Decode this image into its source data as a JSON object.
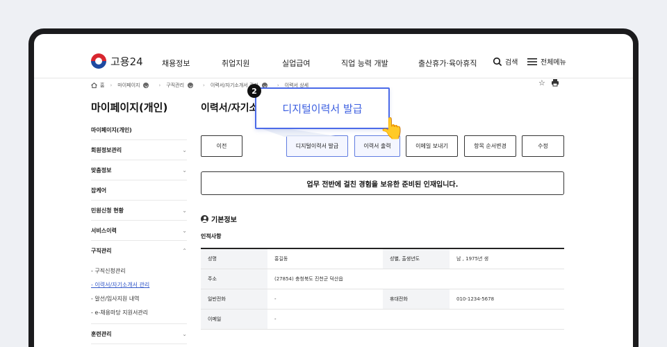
{
  "header": {
    "logo_text": "고용24",
    "nav": [
      "채용정보",
      "취업지원",
      "실업급여",
      "직업 능력 개발",
      "출산휴가·육아휴직"
    ],
    "search_label": "검색",
    "menu_label": "전체메뉴"
  },
  "breadcrumb": {
    "home": "홈",
    "items": [
      "마이페이지",
      "구직관리",
      "이력서/자기소개서 관리",
      "이력서 상세"
    ]
  },
  "sidebar": {
    "title": "마이페이지(개인)",
    "items": [
      {
        "label": "마이페이지(개인)"
      },
      {
        "label": "회원정보관리"
      },
      {
        "label": "맞춤정보"
      },
      {
        "label": "잡케어"
      },
      {
        "label": "민원신청 현황"
      },
      {
        "label": "서비스이력"
      },
      {
        "label": "구직관리"
      },
      {
        "label": "훈련관리"
      }
    ],
    "sub_items": [
      "- 구직신청관리",
      "- 이력서/자기소개서 관리",
      "- 알선/입사지원 내역",
      "- e-채용마당 지원서관리"
    ]
  },
  "main": {
    "title": "이력서/자기소개서 상세",
    "buttons": [
      "이전",
      "디지털이력서 발급",
      "이력서 출력",
      "이메일 보내기",
      "항목 순서변경",
      "수정"
    ],
    "notice": "업무 전반에 걸친 경험을 보유한 준비된 인재입니다.",
    "section_title": "기본정보",
    "sub_title": "인적사항",
    "table": {
      "name_label": "성명",
      "name": "홍길동",
      "gender_label": "성별, 출생년도",
      "gender": "남 , 1975년 생",
      "address_label": "주소",
      "address": "(27854) 충청북도 진천군 덕산읍",
      "phone_label": "일반전화",
      "phone": "-",
      "mobile_label": "휴대전화",
      "mobile": "010-1234-5678",
      "email_label": "이메일",
      "email": "-"
    }
  },
  "callout": {
    "step": "2",
    "text": "디지털이력서 발급"
  }
}
